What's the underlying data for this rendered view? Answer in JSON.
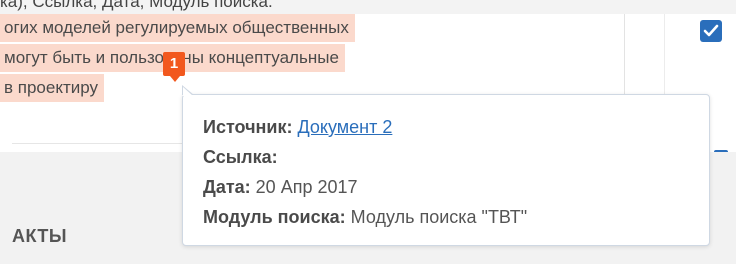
{
  "top_cut_text": "ка), Ссылка, Дата, Модуль поиска.",
  "highlight": {
    "lines": [
      "огих моделей регулируемых общественных",
      " могут быть и   пользованы концептуальные",
      " в проектиру"
    ],
    "badge": "1",
    "color": "#fbd9cc",
    "badge_color": "#f2581e"
  },
  "tooltip": {
    "source_label": "Источник:",
    "source_link": "Документ 2",
    "reference_label": "Ссылка:",
    "date_label": "Дата:",
    "date_value": "20 Апр 2017",
    "module_label": "Модуль поиска:",
    "module_value": "Модуль поиска \"ТВТ\""
  },
  "section": {
    "title": "АКТЫ"
  },
  "checkbox": {
    "checked": true,
    "color": "#2a6ebb"
  }
}
